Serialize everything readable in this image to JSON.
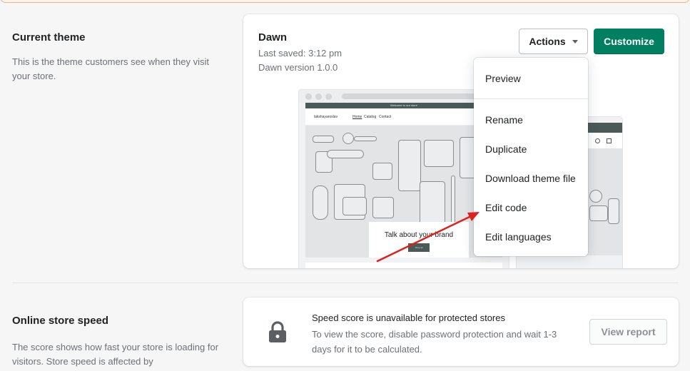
{
  "current_theme": {
    "title": "Current theme",
    "description": "This is the theme customers see when they visit your store.",
    "theme_name": "Dawn",
    "last_saved": "Last saved: 3:12 pm",
    "version": "Dawn version 1.0.0",
    "actions_label": "Actions",
    "customize_label": "Customize",
    "preview": {
      "announcement": "Welcome to our store",
      "store_name": "lakshayaroslav",
      "nav": [
        "Home",
        "Catalog",
        "Contact"
      ],
      "hero_text": "Talk about your brand",
      "hero_button": "Shop all"
    }
  },
  "actions_menu": {
    "items": [
      "Preview",
      "Rename",
      "Duplicate",
      "Download theme file",
      "Edit code",
      "Edit languages"
    ]
  },
  "annotation": {
    "color": "#e0201c"
  },
  "online_store_speed": {
    "title": "Online store speed",
    "description": "The score shows how fast your store is loading for visitors. Store speed is affected by",
    "status_title": "Speed score is unavailable for protected stores",
    "status_desc": "To view the score, disable password protection and wait 1-3 days for it to be calculated.",
    "view_report_label": "View report"
  },
  "colors": {
    "primary": "#008060",
    "background": "#f6f6f7",
    "text_subdued": "#6d7175"
  }
}
